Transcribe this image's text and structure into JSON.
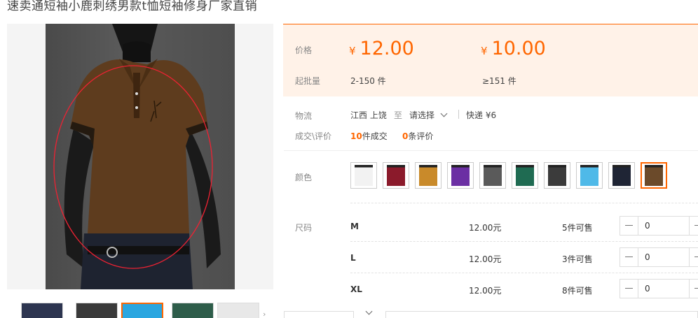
{
  "product": {
    "title": "速卖通短袖小鹿刺绣男款t恤短袖修身厂家直销"
  },
  "price_block": {
    "price_label": "价格",
    "moq_label": "起批量",
    "tiers": [
      {
        "currency": "¥",
        "price": "12.00",
        "qty": "2-150 件"
      },
      {
        "currency": "¥",
        "price": "10.00",
        "qty": "≥151 件"
      }
    ]
  },
  "logistics": {
    "label": "物流",
    "from": "江西 上饶",
    "to_word": "至",
    "dest_placeholder": "请选择",
    "express": "快递 ¥6"
  },
  "deals": {
    "label": "成交\\评价",
    "deal_count": "10",
    "deal_suffix": "件成交",
    "review_count": "0",
    "review_suffix": "条评价"
  },
  "colors": {
    "label": "颜色",
    "swatches": [
      "#f2f2f2",
      "#8b1a2b",
      "#c98a2a",
      "#6b2fa3",
      "#5a5a5a",
      "#1f6b52",
      "#3b3b3b",
      "#4fb9e8",
      "#1f2535",
      "#6b4a2a"
    ],
    "selected_index": 9
  },
  "sizes": {
    "label": "尺码",
    "rows": [
      {
        "name": "M",
        "price": "12.00元",
        "stock": "5件可售",
        "qty": "0"
      },
      {
        "name": "L",
        "price": "12.00元",
        "stock": "3件可售",
        "qty": "0"
      },
      {
        "name": "XL",
        "price": "12.00元",
        "stock": "8件可售",
        "qty": "0"
      }
    ]
  },
  "gallery": {
    "thumb_colors": [
      "#2d3550",
      "#3a3a3a",
      "#2aa6e0",
      "#2e5d4a",
      "#e8e8e8"
    ],
    "active_thumb": 2,
    "next_arrow": "›"
  },
  "accent_color": "#ff6600"
}
